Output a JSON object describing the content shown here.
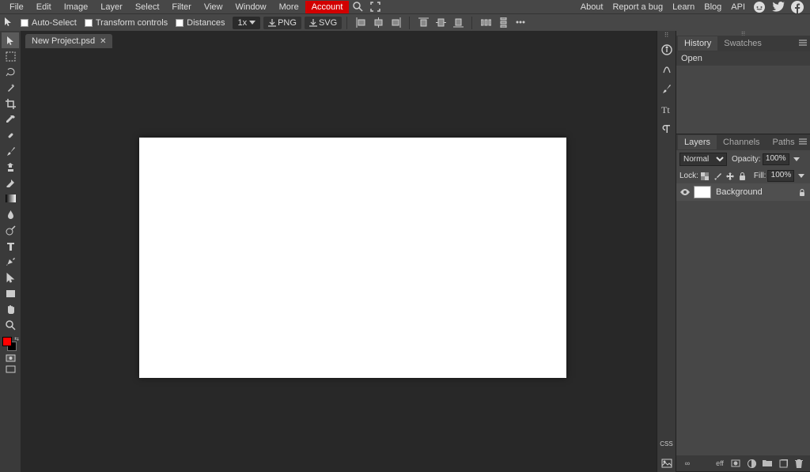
{
  "menu": {
    "file": "File",
    "edit": "Edit",
    "image": "Image",
    "layer": "Layer",
    "select": "Select",
    "filter": "Filter",
    "view": "View",
    "window": "Window",
    "more": "More",
    "account": "Account"
  },
  "toplinks": {
    "about": "About",
    "bug": "Report a bug",
    "learn": "Learn",
    "blog": "Blog",
    "api": "API"
  },
  "opt": {
    "autoselect": "Auto-Select",
    "transform": "Transform controls",
    "distances": "Distances",
    "zoom": "1x",
    "png": "PNG",
    "svg": "SVG"
  },
  "tabs": {
    "name": "New Project.psd"
  },
  "historyTabs": {
    "history": "History",
    "swatches": "Swatches"
  },
  "history": {
    "open": "Open"
  },
  "layerTabs": {
    "layers": "Layers",
    "channels": "Channels",
    "paths": "Paths"
  },
  "layers": {
    "blend": "Normal",
    "opLabel": "Opacity:",
    "opacity": "100%",
    "lockLabel": "Lock:",
    "fillLabel": "Fill:",
    "fill": "100%",
    "layer0": "Background"
  },
  "sidecss": "CSS",
  "footlink": "eff"
}
